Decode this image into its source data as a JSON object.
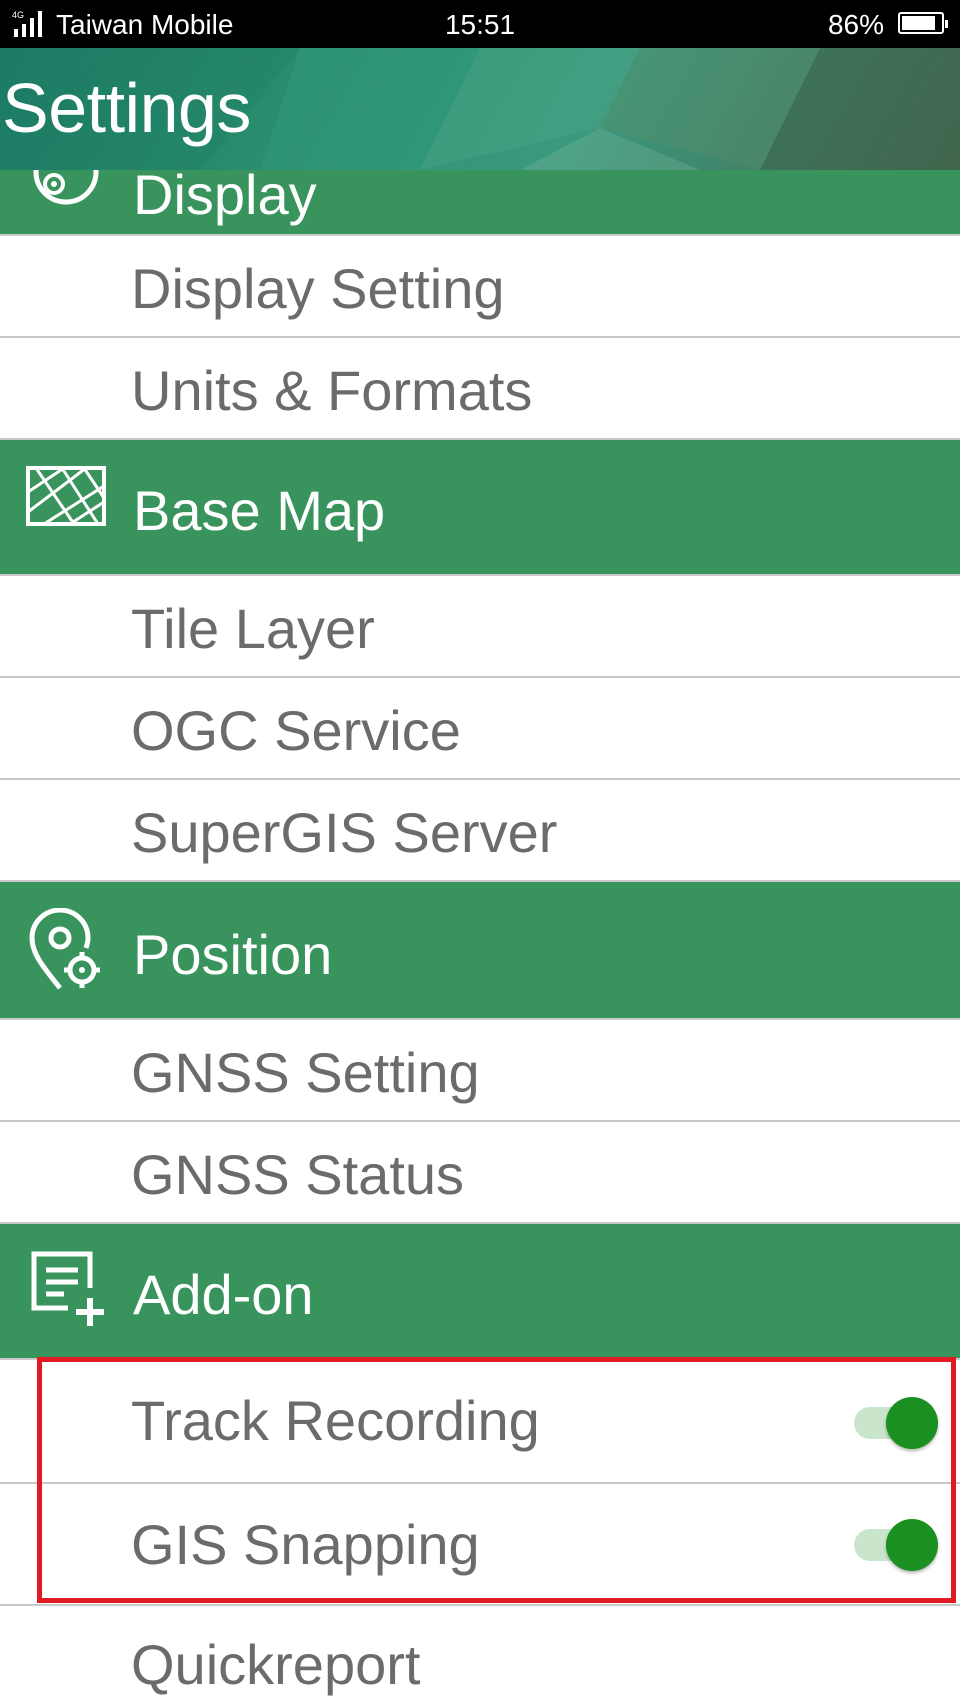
{
  "status_bar": {
    "network": "4G",
    "carrier": "Taiwan Mobile",
    "time": "15:51",
    "battery_percent": "86%",
    "battery_level": 0.86
  },
  "header": {
    "title": "Settings"
  },
  "colors": {
    "section_green": "#38945c",
    "toggle_on": "#1a9020",
    "highlight_red": "#e01b24"
  },
  "sections": {
    "display": {
      "label": "Display",
      "icon": "display-settings-icon",
      "items": [
        "Display Setting",
        "Units & Formats"
      ]
    },
    "base_map": {
      "label": "Base Map",
      "icon": "map-icon",
      "items": [
        "Tile Layer",
        "OGC Service",
        "SuperGIS Server"
      ]
    },
    "position": {
      "label": "Position",
      "icon": "location-target-icon",
      "items": [
        "GNSS Setting",
        "GNSS Status"
      ]
    },
    "add_on": {
      "label": "Add-on",
      "icon": "add-document-icon",
      "items": [
        {
          "label": "Track Recording",
          "toggle": true
        },
        {
          "label": "GIS Snapping",
          "toggle": true
        },
        {
          "label": "Quickreport"
        }
      ]
    }
  }
}
